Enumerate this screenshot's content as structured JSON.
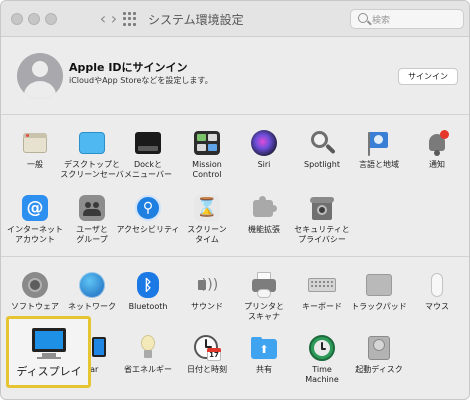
{
  "window": {
    "title": "システム環境設定",
    "search_placeholder": "検索"
  },
  "account": {
    "title": "Apple IDにサインイン",
    "subtitle": "iCloudやApp Storeなどを設定します。",
    "signin_button": "サインイン"
  },
  "row1": [
    {
      "label": "一般",
      "icon": "general-icon"
    },
    {
      "label": "デスクトップと\nスクリーンセーバ",
      "icon": "desktop-icon"
    },
    {
      "label": "Dockと\nメニューバー",
      "icon": "dock-icon"
    },
    {
      "label": "Mission\nControl",
      "icon": "mission-control-icon"
    },
    {
      "label": "Siri",
      "icon": "siri-icon"
    },
    {
      "label": "Spotlight",
      "icon": "spotlight-icon"
    },
    {
      "label": "言語と地域",
      "icon": "language-icon"
    },
    {
      "label": "通知",
      "icon": "notification-icon"
    }
  ],
  "row2": [
    {
      "label": "インターネット\nアカウント",
      "icon": "internet-accounts-icon"
    },
    {
      "label": "ユーザと\nグループ",
      "icon": "users-icon"
    },
    {
      "label": "アクセシビリティ",
      "icon": "accessibility-icon"
    },
    {
      "label": "スクリーン\nタイム",
      "icon": "screen-time-icon"
    },
    {
      "label": "機能拡張",
      "icon": "extensions-icon"
    },
    {
      "label": "セキュリティと\nプライバシー",
      "icon": "security-icon"
    }
  ],
  "row3": [
    {
      "label": "ソフトウェア",
      "icon": "software-update-icon"
    },
    {
      "label": "ネットワーク",
      "icon": "network-icon"
    },
    {
      "label": "Bluetooth",
      "icon": "bluetooth-icon"
    },
    {
      "label": "サウンド",
      "icon": "sound-icon"
    },
    {
      "label": "プリンタと\nスキャナ",
      "icon": "printer-icon"
    },
    {
      "label": "キーボード",
      "icon": "keyboard-icon"
    },
    {
      "label": "トラックパッド",
      "icon": "trackpad-icon"
    },
    {
      "label": "マウス",
      "icon": "mouse-icon"
    }
  ],
  "row4": [
    {
      "label": "ディスプレイ",
      "icon": "display-icon"
    },
    {
      "label": "car",
      "icon": "sidecar-icon"
    },
    {
      "label": "省エネルギー",
      "icon": "energy-icon"
    },
    {
      "label": "日付と時刻",
      "icon": "date-time-icon"
    },
    {
      "label": "共有",
      "icon": "sharing-icon"
    },
    {
      "label": "Time\nMachine",
      "icon": "time-machine-icon"
    },
    {
      "label": "起動ディスク",
      "icon": "startup-disk-icon"
    }
  ],
  "date_icon_day": "17"
}
